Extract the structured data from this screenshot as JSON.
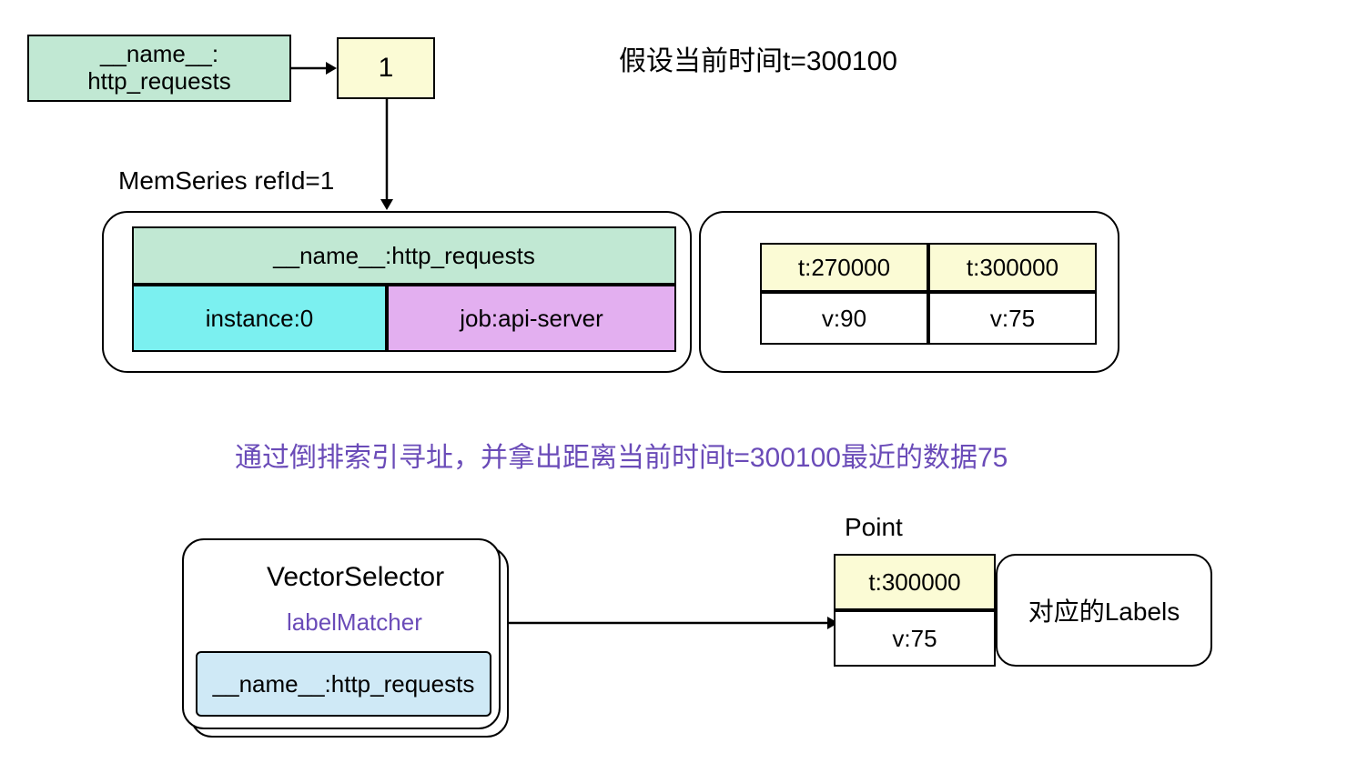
{
  "top": {
    "name_label_line1": "__name__:",
    "name_label_line2": "http_requests",
    "ref_id": "1",
    "assumption": "假设当前时间t=300100"
  },
  "memseries_title": "MemSeries refId=1",
  "memseries": {
    "name_full": "__name__:http_requests",
    "instance": "instance:0",
    "job": "job:api-server"
  },
  "samples": {
    "t1": "t:270000",
    "t2": "t:300000",
    "v1": "v:90",
    "v2": "v:75"
  },
  "middle_note": "通过倒排索引寻址，并拿出距离当前时间t=300100最近的数据75",
  "vector_selector": {
    "title": "VectorSelector",
    "subtitle": "labelMatcher",
    "label": "__name__:http_requests"
  },
  "point": {
    "title": "Point",
    "t": "t:300000",
    "v": "v:75",
    "labels": "对应的Labels"
  }
}
